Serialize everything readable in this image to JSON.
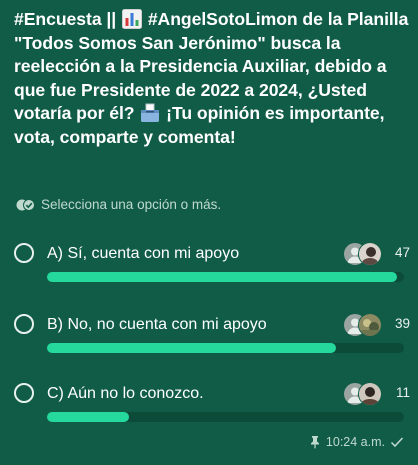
{
  "poll": {
    "question_parts": {
      "p1": "#Encuesta || ",
      "p2": " #AngelSotoLimon de la Planilla \"Todos Somos San Jerónimo\" busca la reelección a la Presidencia Auxiliar, debido a que fue Presidente de 2022 a 2024, ¿Usted votaría por él? ",
      "p3": " ¡Tu opinión es importante, vota, comparte y comenta!"
    },
    "hint": "Selecciona una opción o más.",
    "options": [
      {
        "label": "A) Sí, cuenta con mi apoyo",
        "votes": "47",
        "fraction": 0.98
      },
      {
        "label": "B) No, no cuenta con mi apoyo",
        "votes": "39",
        "fraction": 0.81
      },
      {
        "label": "C) Aún no lo conozco.",
        "votes": "11",
        "fraction": 0.23
      }
    ]
  },
  "message": {
    "time": "10:24 a.m."
  },
  "colors": {
    "background": "#115c46",
    "bar_fill": "#25d99d",
    "bar_track": "#0b4b38",
    "muted_text": "#bfd9cf"
  },
  "icons": [
    "bar-chart-emoji-icon",
    "ballot-box-emoji-icon",
    "double-check-icon",
    "pin-icon",
    "check-icon"
  ]
}
